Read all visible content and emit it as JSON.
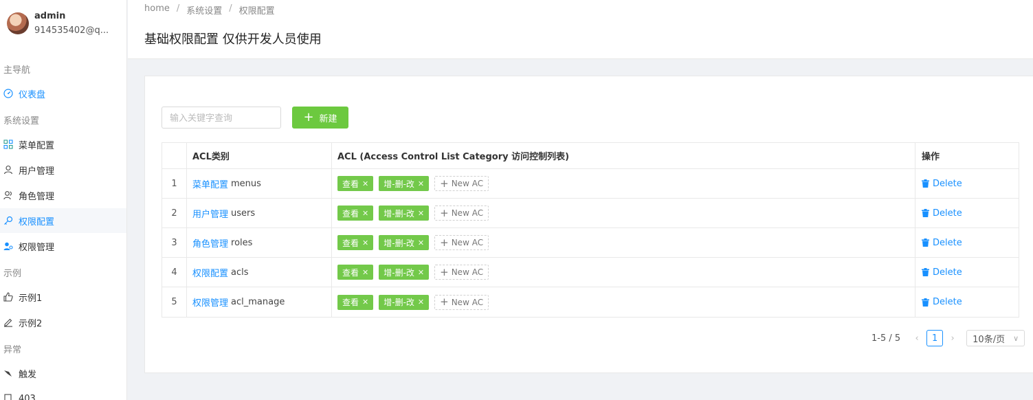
{
  "user": {
    "name": "admin",
    "email": "914535402@q..."
  },
  "sidebar": {
    "groups": [
      {
        "label": "主导航"
      },
      {
        "label": "系统设置"
      },
      {
        "label": "示例"
      },
      {
        "label": "异常"
      }
    ],
    "items": [
      {
        "label": "仪表盘",
        "icon": "dashboard-icon"
      },
      {
        "label": "菜单配置",
        "icon": "grid-icon"
      },
      {
        "label": "用户管理",
        "icon": "user-icon"
      },
      {
        "label": "角色管理",
        "icon": "users-icon"
      },
      {
        "label": "权限配置",
        "icon": "key-icon"
      },
      {
        "label": "权限管理",
        "icon": "user-key-icon"
      },
      {
        "label": "示例1",
        "icon": "like-icon"
      },
      {
        "label": "示例2",
        "icon": "edit-icon"
      },
      {
        "label": "触发",
        "icon": "bug-icon"
      },
      {
        "label": "403",
        "icon": "file-icon"
      }
    ]
  },
  "header": {
    "breadcrumb": [
      "home",
      "系统设置",
      "权限配置"
    ],
    "separator": "/",
    "title": "基础权限配置 仅供开发人员使用"
  },
  "toolbar": {
    "search_placeholder": "输入关键字查询",
    "new_label": "新建"
  },
  "table": {
    "headers": [
      "ACL类别",
      "ACL (Access Control List Category 访问控制列表)",
      "操作"
    ],
    "rows": [
      {
        "idx": "1",
        "name": "菜单配置",
        "key": "menus"
      },
      {
        "idx": "2",
        "name": "用户管理",
        "key": "users"
      },
      {
        "idx": "3",
        "name": "角色管理",
        "key": "roles"
      },
      {
        "idx": "4",
        "name": "权限配置",
        "key": "acls"
      },
      {
        "idx": "5",
        "name": "权限管理",
        "key": "acl_manage"
      }
    ],
    "tags": [
      "查看",
      "增-删-改"
    ],
    "new_ac_label": "New AC",
    "delete_label": "Delete"
  },
  "pagination": {
    "total": "1-5 / 5",
    "current": "1",
    "page_size": "10条/页"
  },
  "colors": {
    "primary": "#1890ff",
    "success": "#6cc93f"
  }
}
